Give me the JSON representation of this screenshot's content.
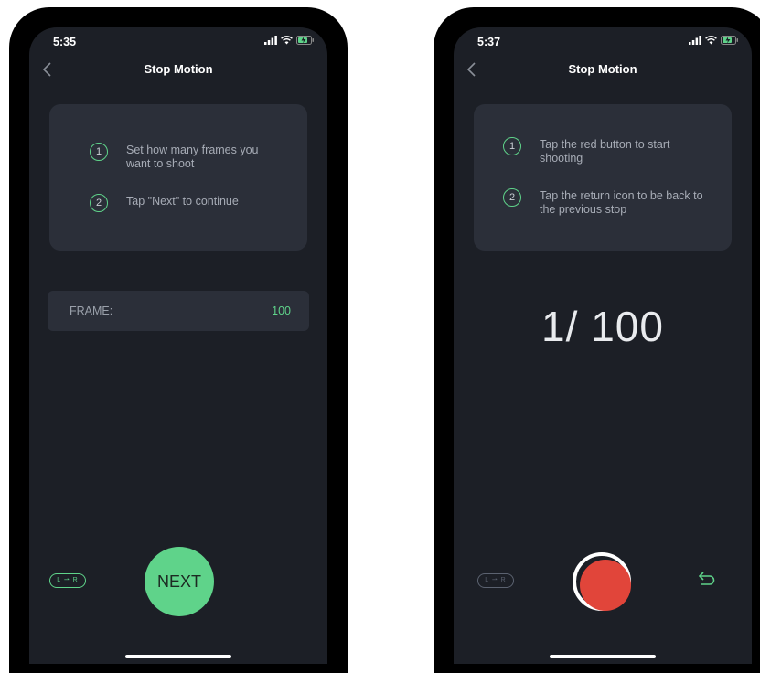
{
  "left": {
    "status": {
      "time": "5:35"
    },
    "nav": {
      "title": "Stop Motion"
    },
    "steps": [
      {
        "num": "1",
        "text": "Set how many frames you want to shoot"
      },
      {
        "num": "2",
        "text": "Tap \"Next\" to continue"
      }
    ],
    "frame": {
      "label": "FRAME:",
      "value": "100"
    },
    "toggle_label": "L ⇀ R",
    "next_label": "NEXT"
  },
  "right": {
    "status": {
      "time": "5:37"
    },
    "nav": {
      "title": "Stop Motion"
    },
    "steps": [
      {
        "num": "1",
        "text": "Tap the red button to start shooting"
      },
      {
        "num": "2",
        "text": "Tap the return icon to be back to the previous stop"
      }
    ],
    "counter": "1/ 100",
    "toggle_label": "L ⇀ R"
  },
  "colors": {
    "accent_green": "#5fd38a",
    "record_red": "#e1453a",
    "background": "#1c1f26",
    "card": "#2b2f39"
  },
  "icons": {
    "back": "chevron-left-icon",
    "signal": "signal-icon",
    "wifi": "wifi-icon",
    "battery": "battery-charging-icon",
    "undo": "return-arrow-icon"
  }
}
